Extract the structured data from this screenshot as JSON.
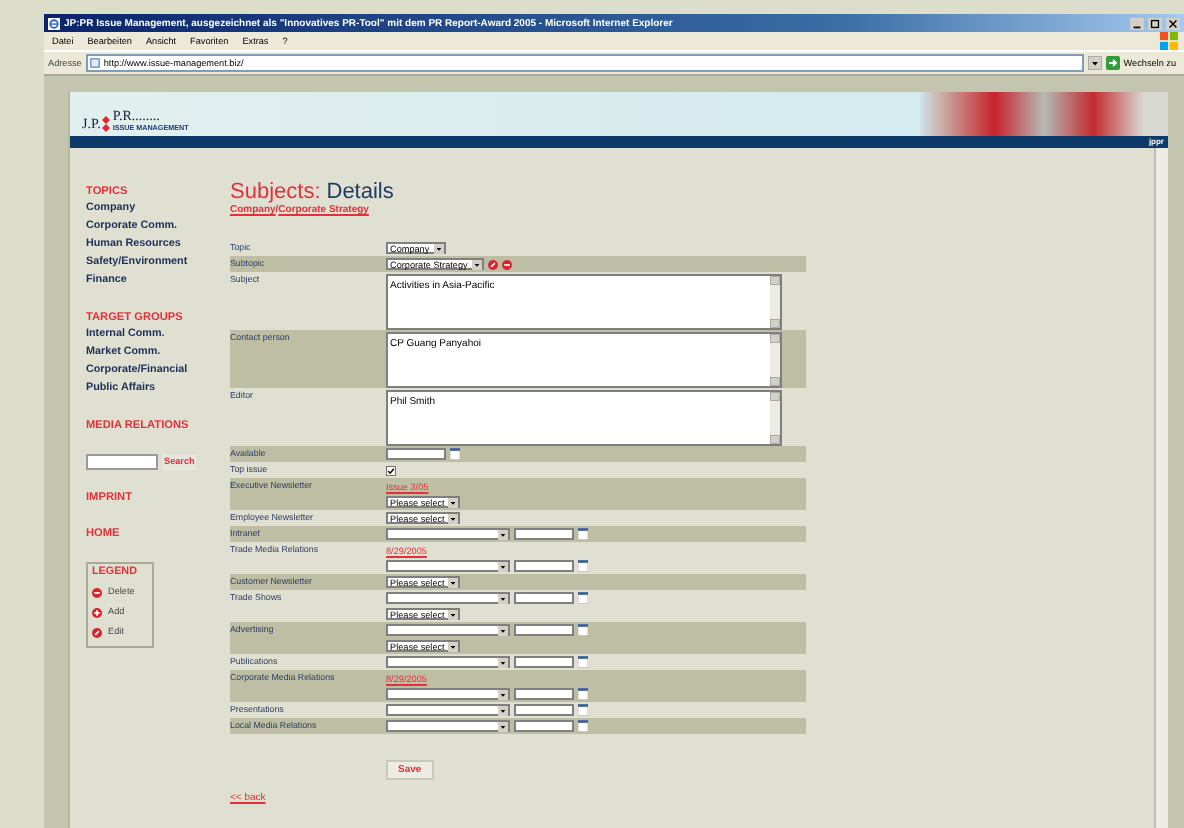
{
  "window": {
    "title": "JP:PR Issue Management, ausgezeichnet als \"Innovatives PR-Tool\" mit dem PR Report-Award 2005 - Microsoft Internet Explorer"
  },
  "menu": [
    "Datei",
    "Bearbeiten",
    "Ansicht",
    "Favoriten",
    "Extras",
    "?"
  ],
  "address_bar": {
    "label": "Adresse",
    "url": "http://www.issue-management.biz/",
    "go": "Wechseln zu"
  },
  "header": {
    "logo_left": "J.P.",
    "logo_right": "P.R........",
    "tagline": "ISSUE MANAGEMENT",
    "bar_text": "jppr"
  },
  "sidebar": [
    {
      "kind": "section",
      "heading": "TOPICS",
      "items": [
        "Company",
        "Corporate Comm.",
        "Human Resources",
        "Safety/Environment",
        "Finance"
      ]
    },
    {
      "kind": "section",
      "heading": "TARGET GROUPS",
      "items": [
        "Internal Comm.",
        "Market Comm.",
        "Corporate/Financial",
        "Public Affairs"
      ]
    },
    {
      "kind": "link",
      "heading": "MEDIA RELATIONS"
    },
    {
      "kind": "search",
      "button": "Search"
    },
    {
      "kind": "link",
      "heading": "IMPRINT"
    },
    {
      "kind": "link",
      "heading": "HOME"
    }
  ],
  "legend": {
    "title": "LEGEND",
    "items": [
      {
        "kind": "delete",
        "label": "Delete"
      },
      {
        "kind": "add",
        "label": "Add"
      },
      {
        "kind": "edit",
        "label": "Edit"
      }
    ]
  },
  "page": {
    "title": "Subjects:",
    "subtitle": "Details",
    "breadcrumb": [
      "Company",
      "Corporate Strategy"
    ],
    "separator": "/"
  },
  "form": {
    "rows": [
      {
        "label": "Topic",
        "lines": [
          [
            {
              "kind": "select",
              "value": "Company"
            }
          ]
        ]
      },
      {
        "label": "Subtopic",
        "lines": [
          [
            {
              "kind": "select",
              "value": "Corporate Strategy"
            },
            {
              "kind": "edit_icon"
            },
            {
              "kind": "delete_icon"
            }
          ]
        ]
      },
      {
        "label": "Subject",
        "lines": [
          [
            {
              "kind": "textarea",
              "value": "Activities in Asia-Pacific"
            }
          ]
        ]
      },
      {
        "label": "Contact person",
        "lines": [
          [
            {
              "kind": "textarea",
              "value": "CP Guang Panyahoi"
            }
          ]
        ]
      },
      {
        "label": "Editor",
        "lines": [
          [
            {
              "kind": "textarea",
              "value": "Phil Smith"
            }
          ]
        ]
      },
      {
        "label": "Available",
        "lines": [
          [
            {
              "kind": "date"
            }
          ]
        ]
      },
      {
        "label": "Top issue",
        "lines": [
          [
            {
              "kind": "checkbox",
              "checked": true
            }
          ]
        ]
      },
      {
        "label": "Executive Newsletter",
        "lines": [
          [
            {
              "kind": "link",
              "value": "Issue 3/05"
            }
          ],
          [
            {
              "kind": "select",
              "value": "Please select"
            }
          ]
        ]
      },
      {
        "label": "Employee Newsletter",
        "lines": [
          [
            {
              "kind": "select",
              "value": "Please select"
            }
          ]
        ]
      },
      {
        "label": "Intranet",
        "lines": [
          [
            {
              "kind": "select"
            },
            {
              "kind": "date"
            }
          ]
        ]
      },
      {
        "label": "Trade Media Relations",
        "lines": [
          [
            {
              "kind": "link",
              "value": "8/29/2005"
            }
          ],
          [
            {
              "kind": "select"
            },
            {
              "kind": "date"
            }
          ]
        ]
      },
      {
        "label": "Customer Newsletter",
        "lines": [
          [
            {
              "kind": "select",
              "value": "Please select"
            }
          ]
        ]
      },
      {
        "label": "Trade Shows",
        "lines": [
          [
            {
              "kind": "select"
            },
            {
              "kind": "date"
            }
          ],
          [
            {
              "kind": "select",
              "value": "Please select"
            }
          ]
        ]
      },
      {
        "label": "Advertising",
        "lines": [
          [
            {
              "kind": "select"
            },
            {
              "kind": "date"
            }
          ],
          [
            {
              "kind": "select",
              "value": "Please select"
            }
          ]
        ]
      },
      {
        "label": "Publications",
        "lines": [
          [
            {
              "kind": "select"
            },
            {
              "kind": "date"
            }
          ]
        ]
      },
      {
        "label": "Corporate Media Relations",
        "lines": [
          [
            {
              "kind": "link",
              "value": "8/29/2005"
            }
          ],
          [
            {
              "kind": "select"
            },
            {
              "kind": "date"
            }
          ]
        ]
      },
      {
        "label": "Presentations",
        "lines": [
          [
            {
              "kind": "select"
            },
            {
              "kind": "date"
            }
          ]
        ]
      },
      {
        "label": "Local Media Relations",
        "lines": [
          [
            {
              "kind": "select"
            },
            {
              "kind": "date"
            }
          ]
        ]
      }
    ],
    "save": "Save"
  },
  "back_link": "<< back"
}
